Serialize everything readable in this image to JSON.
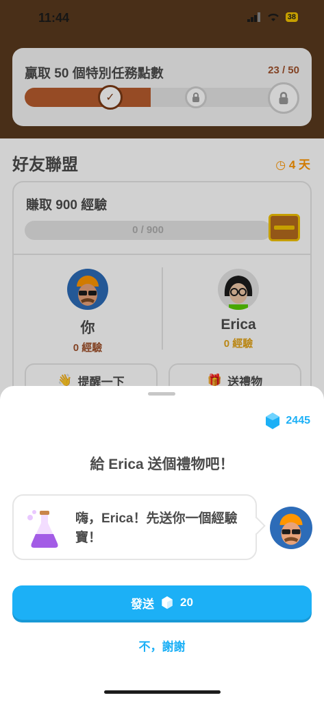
{
  "status_bar": {
    "time": "11:44",
    "battery": "38"
  },
  "quest": {
    "title": "贏取 50 個特別任務點數",
    "progress": "23 / 50",
    "progress_fraction": 0.46
  },
  "league": {
    "title": "好友聯盟",
    "days_left": "4 天",
    "goal_title": "賺取 900 經驗",
    "goal_progress": "0 / 900",
    "players": [
      {
        "name": "你",
        "xp": "0 經驗"
      },
      {
        "name": "Erica",
        "xp": "0 經驗"
      }
    ],
    "actions": {
      "nudge": "提醒一下",
      "gift": "送禮物"
    }
  },
  "sheet": {
    "gems": "2445",
    "title": "給 Erica 送個禮物吧！",
    "message": "嗨，Erica！先送你一個經驗寶！",
    "send_label": "發送",
    "send_cost": "20",
    "decline_label": "不，謝謝"
  },
  "colors": {
    "accent": "#1cb0f6",
    "brown": "#5a3a1e",
    "orange": "#ff9600"
  }
}
